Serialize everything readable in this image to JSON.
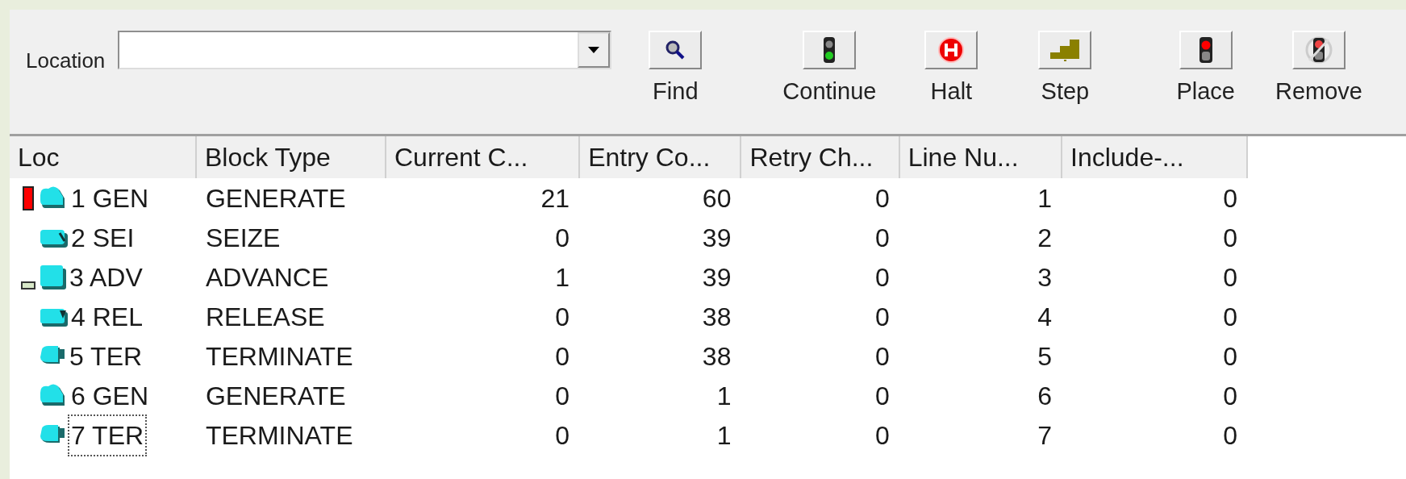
{
  "toolbar": {
    "location_label": "Location",
    "buttons": [
      {
        "kind": "find",
        "label": "Find"
      },
      {
        "kind": "continue",
        "label": "Continue"
      },
      {
        "kind": "halt",
        "label": "Halt"
      },
      {
        "kind": "step",
        "label": "Step"
      },
      {
        "kind": "place",
        "label": "Place"
      },
      {
        "kind": "remove",
        "label": "Remove"
      }
    ]
  },
  "table": {
    "columns": [
      "Loc",
      "Block Type",
      "Current C...",
      "Entry Co...",
      "Retry Ch...",
      "Line Nu...",
      "Include-..."
    ],
    "rows": [
      {
        "kind": "generate",
        "breakpoint": true,
        "marker": false,
        "focused": false,
        "cells": [
          "1 GEN",
          "GENERATE",
          "21",
          "60",
          "0",
          "1",
          "0"
        ]
      },
      {
        "kind": "seize",
        "breakpoint": false,
        "marker": false,
        "focused": false,
        "cells": [
          "2 SEI",
          "SEIZE",
          "0",
          "39",
          "0",
          "2",
          "0"
        ]
      },
      {
        "kind": "advance",
        "breakpoint": false,
        "marker": true,
        "focused": false,
        "cells": [
          "3 ADV",
          "ADVANCE",
          "1",
          "39",
          "0",
          "3",
          "0"
        ]
      },
      {
        "kind": "release",
        "breakpoint": false,
        "marker": false,
        "focused": false,
        "cells": [
          "4 REL",
          "RELEASE",
          "0",
          "38",
          "0",
          "4",
          "0"
        ]
      },
      {
        "kind": "terminate",
        "breakpoint": false,
        "marker": false,
        "focused": false,
        "cells": [
          "5 TER",
          "TERMINATE",
          "0",
          "38",
          "0",
          "5",
          "0"
        ]
      },
      {
        "kind": "generate",
        "breakpoint": false,
        "marker": false,
        "focused": false,
        "cells": [
          "6 GEN",
          "GENERATE",
          "0",
          "1",
          "0",
          "6",
          "0"
        ]
      },
      {
        "kind": "terminate",
        "breakpoint": false,
        "marker": false,
        "focused": true,
        "cells": [
          "7 TER",
          "TERMINATE",
          "0",
          "1",
          "0",
          "7",
          "0"
        ]
      }
    ]
  }
}
